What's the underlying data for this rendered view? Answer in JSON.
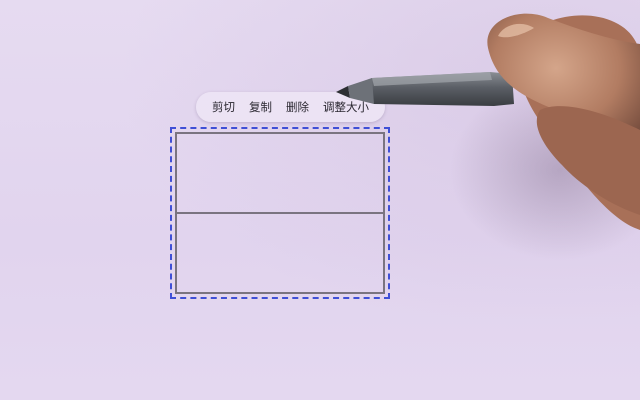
{
  "context_menu": {
    "items": [
      {
        "label": "剪切"
      },
      {
        "label": "复制"
      },
      {
        "label": "删除"
      },
      {
        "label": "调整大小"
      }
    ]
  },
  "drawing": {
    "rows": 2
  },
  "colors": {
    "background": "#e3d7ef",
    "selection_border": "#3f4fd6",
    "ink": "#7a7480"
  },
  "icons": [
    "stylus-pen-icon"
  ]
}
